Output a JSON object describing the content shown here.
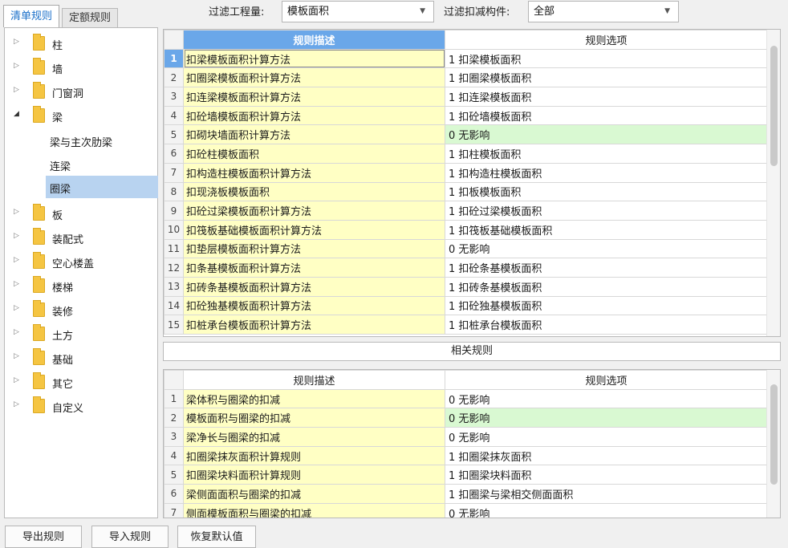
{
  "tabs": [
    {
      "label": "清单规则",
      "active": true
    },
    {
      "label": "定额规则",
      "active": false
    }
  ],
  "filters": {
    "quantity_label": "过滤工程量:",
    "quantity_value": "模板面积",
    "component_label": "过滤扣减构件:",
    "component_value": "全部"
  },
  "tree": {
    "nodes": [
      {
        "label": "柱",
        "expanded": false
      },
      {
        "label": "墙",
        "expanded": false
      },
      {
        "label": "门窗洞",
        "expanded": false
      },
      {
        "label": "梁",
        "expanded": true,
        "children": [
          "梁与主次肋梁",
          "连梁",
          "圈梁"
        ],
        "selected_child": "圈梁"
      },
      {
        "label": "板",
        "expanded": false
      },
      {
        "label": "装配式",
        "expanded": false
      },
      {
        "label": "空心楼盖",
        "expanded": false
      },
      {
        "label": "楼梯",
        "expanded": false
      },
      {
        "label": "装修",
        "expanded": false
      },
      {
        "label": "土方",
        "expanded": false
      },
      {
        "label": "基础",
        "expanded": false
      },
      {
        "label": "其它",
        "expanded": false
      },
      {
        "label": "自定义",
        "expanded": false
      }
    ]
  },
  "rules_grid": {
    "headers": {
      "description": "规则描述",
      "option": "规则选项"
    },
    "current_row": 1,
    "rows": [
      {
        "num": "1",
        "description": "扣梁模板面积计算方法",
        "option": "1  扣梁模板面积",
        "highlight": false
      },
      {
        "num": "2",
        "description": "扣圈梁模板面积计算方法",
        "option": "1  扣圈梁模板面积",
        "highlight": false
      },
      {
        "num": "3",
        "description": "扣连梁模板面积计算方法",
        "option": "1 扣连梁模板面积",
        "highlight": false
      },
      {
        "num": "4",
        "description": "扣砼墙模板面积计算方法",
        "option": "1 扣砼墙模板面积",
        "highlight": false
      },
      {
        "num": "5",
        "description": "扣砌块墙面积计算方法",
        "option": "0  无影响",
        "highlight": true
      },
      {
        "num": "6",
        "description": "扣砼柱模板面积",
        "option": "1 扣柱模板面积",
        "highlight": false
      },
      {
        "num": "7",
        "description": "扣构造柱模板面积计算方法",
        "option": "1 扣构造柱模板面积",
        "highlight": false
      },
      {
        "num": "8",
        "description": "扣现浇板模板面积",
        "option": "1 扣板模板面积",
        "highlight": false
      },
      {
        "num": "9",
        "description": "扣砼过梁模板面积计算方法",
        "option": "1 扣砼过梁模板面积",
        "highlight": false
      },
      {
        "num": "10",
        "description": "扣筏板基础模板面积计算方法",
        "option": "1 扣筏板基础模板面积",
        "highlight": false
      },
      {
        "num": "11",
        "description": "扣垫层模板面积计算方法",
        "option": "0  无影响",
        "highlight": false
      },
      {
        "num": "12",
        "description": "扣条基模板面积计算方法",
        "option": "1 扣砼条基模板面积",
        "highlight": false
      },
      {
        "num": "13",
        "description": "扣砖条基模板面积计算方法",
        "option": "1 扣砖条基模板面积",
        "highlight": false
      },
      {
        "num": "14",
        "description": "扣砼独基模板面积计算方法",
        "option": "1 扣砼独基模板面积",
        "highlight": false
      },
      {
        "num": "15",
        "description": "扣桩承台模板面积计算方法",
        "option": "1 扣桩承台模板面积",
        "highlight": false
      }
    ]
  },
  "related_title": "相关规则",
  "related_grid": {
    "headers": {
      "description": "规则描述",
      "option": "规则选项"
    },
    "rows": [
      {
        "num": "1",
        "description": "梁体积与圈梁的扣减",
        "option": "0  无影响",
        "highlight": false
      },
      {
        "num": "2",
        "description": "模板面积与圈梁的扣减",
        "option": "0  无影响",
        "highlight": true
      },
      {
        "num": "3",
        "description": "梁净长与圈梁的扣减",
        "option": "0  无影响",
        "highlight": false
      },
      {
        "num": "4",
        "description": "扣圈梁抹灰面积计算规则",
        "option": "1 扣圈梁抹灰面积",
        "highlight": false
      },
      {
        "num": "5",
        "description": "扣圈梁块料面积计算规则",
        "option": "1 扣圈梁块料面积",
        "highlight": false
      },
      {
        "num": "6",
        "description": "梁侧面面积与圈梁的扣减",
        "option": "1 扣圈梁与梁相交侧面面积",
        "highlight": false
      },
      {
        "num": "7",
        "description": "侧面模板面积与圈梁的扣减",
        "option": "0  无影响",
        "highlight": false
      }
    ]
  },
  "buttons": {
    "export": "导出规则",
    "import": "导入规则",
    "restore": "恢复默认值"
  }
}
